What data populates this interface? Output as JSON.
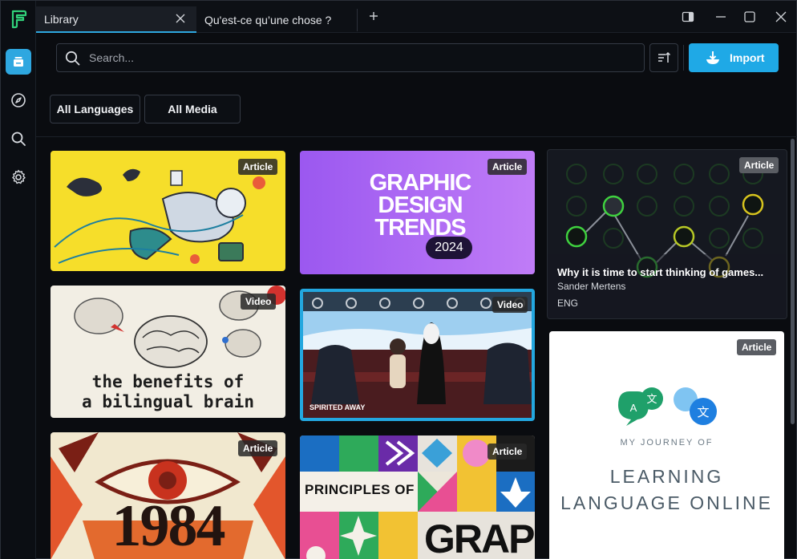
{
  "tabs": [
    {
      "label": "Library",
      "active": true
    },
    {
      "label": "Qu'est-ce qu’une chose ?",
      "active": false
    }
  ],
  "search": {
    "placeholder": "Search..."
  },
  "toolbar": {
    "import_label": "Import"
  },
  "filters": [
    {
      "label": "All Languages"
    },
    {
      "label": "All Media"
    }
  ],
  "accent_color": "#1fa9e6",
  "cards": [
    {
      "badge": "Article"
    },
    {
      "badge": "Article",
      "title_lines": [
        "GRAPHIC",
        "DESIGN",
        "TRENDS"
      ],
      "year": "2024"
    },
    {
      "badge": "Article",
      "title": "Why it is time to start thinking of games...",
      "author": "Sander Mertens",
      "lang": "ENG"
    },
    {
      "badge": "Video",
      "text_line1": "the benefits of",
      "text_line2": "a bilingual brain"
    },
    {
      "badge": "Video",
      "caption": "SPIRITED AWAY"
    },
    {
      "badge": "Article",
      "subtitle": "MY JOURNEY OF",
      "title_line1": "LEARNING",
      "title_line2": "LANGUAGE ONLINE"
    },
    {
      "badge": "Article",
      "text": "1984"
    },
    {
      "badge": "Article",
      "text_line1": "PRINCIPLES OF",
      "text_line2": "GRAPHIC"
    }
  ]
}
